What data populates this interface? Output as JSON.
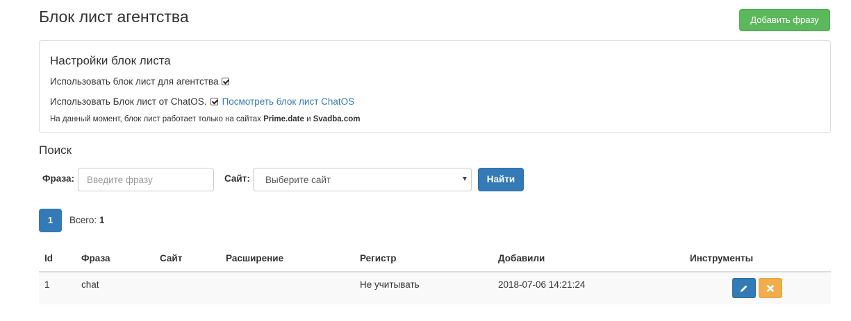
{
  "header": {
    "title": "Блок лист агентства",
    "add_button": "Добавить фразу"
  },
  "settings": {
    "title": "Настройки блок листа",
    "use_agency": "Использовать блок лист для агентства",
    "use_chatos": "Использовать Блок лист от ChatOS.",
    "view_link": "Посмотреть блок лист ChatOS",
    "note_prefix": "На данный момент, блок лист работает только на сайтах",
    "note_site1": "Prime.date",
    "note_and": "и",
    "note_site2": "Svadba.com"
  },
  "search": {
    "title": "Поиск",
    "phrase_label": "Фраза:",
    "phrase_placeholder": "Введите фразу",
    "site_label": "Сайт:",
    "site_selected": "Выберите сайт",
    "find_button": "Найти"
  },
  "pagination": {
    "current_page": "1",
    "total_label": "Всего:",
    "total_value": "1"
  },
  "table": {
    "headers": {
      "id": "Id",
      "phrase": "Фраза",
      "site": "Сайт",
      "extension": "Расширение",
      "register": "Регистр",
      "added": "Добавили",
      "tools": "Инструменты"
    },
    "rows": [
      {
        "id": "1",
        "phrase": "chat",
        "site": "",
        "extension": "",
        "register": "Не учитывать",
        "added": "2018-07-06 14:21:24"
      }
    ]
  },
  "icons": {
    "edit": "pencil-icon",
    "delete": "close-icon"
  },
  "colors": {
    "success": "#5cb85c",
    "primary": "#337ab7",
    "warning": "#f0ad4e",
    "link": "#337ab7"
  }
}
